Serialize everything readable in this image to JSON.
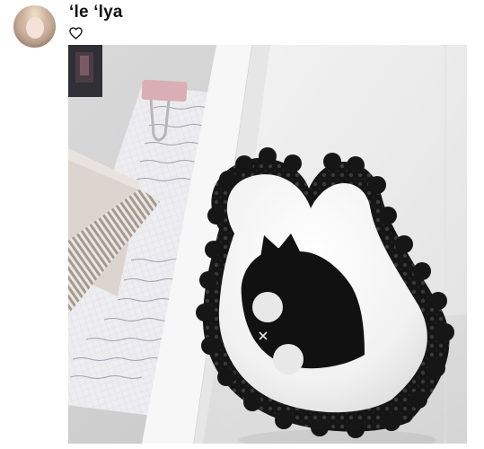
{
  "post": {
    "username": "ʻle ʻlya"
  },
  "icons": {
    "avatar": "user-avatar",
    "like": "heart-outline-icon"
  },
  "photo": {
    "subject": "heart-plush-photo"
  }
}
